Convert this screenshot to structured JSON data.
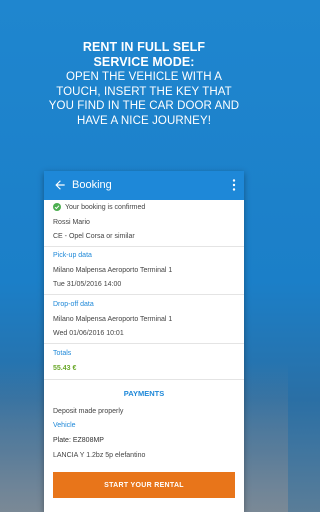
{
  "headline": {
    "line1": "RENT IN FULL SELF",
    "line2": "SERVICE MODE:",
    "line3": "OPEN THE VEHICLE WITH A",
    "line4": "TOUCH, INSERT THE KEY THAT",
    "line5": "YOU FIND IN THE CAR DOOR AND",
    "line6": "HAVE A NICE JOURNEY!"
  },
  "appbar": {
    "title": "Booking"
  },
  "booking": {
    "status": "Your booking is confirmed",
    "customer": "Rossi Mario",
    "vehicle_class": "CE - Opel Corsa or similar",
    "pickup_label": "Pick-up data",
    "pickup_location": "Milano Malpensa Aeroporto Terminal 1",
    "pickup_time": "Tue 31/05/2016 14:00",
    "dropoff_label": "Drop-off data",
    "dropoff_location": "Milano Malpensa Aeroporto Terminal 1",
    "dropoff_time": "Wed 01/06/2016 10:01",
    "totals_label": "Totals",
    "totals_value": "55.43 €",
    "payments_label": "PAYMENTS",
    "deposit": "Deposit made properly",
    "vehicle_label": "Vehicle",
    "plate": "Plate: EZ808MP",
    "model": "LANCIA Y 1.2bz 5p elefantino",
    "start_button": "START YOUR RENTAL"
  },
  "colors": {
    "primary": "#1e88d8",
    "accent": "#e8751a",
    "success": "#4caf50",
    "total": "#6aa82a"
  },
  "icons": {
    "back": "arrow-left-icon",
    "more": "more-vert-icon",
    "status": "check-circle-icon"
  }
}
